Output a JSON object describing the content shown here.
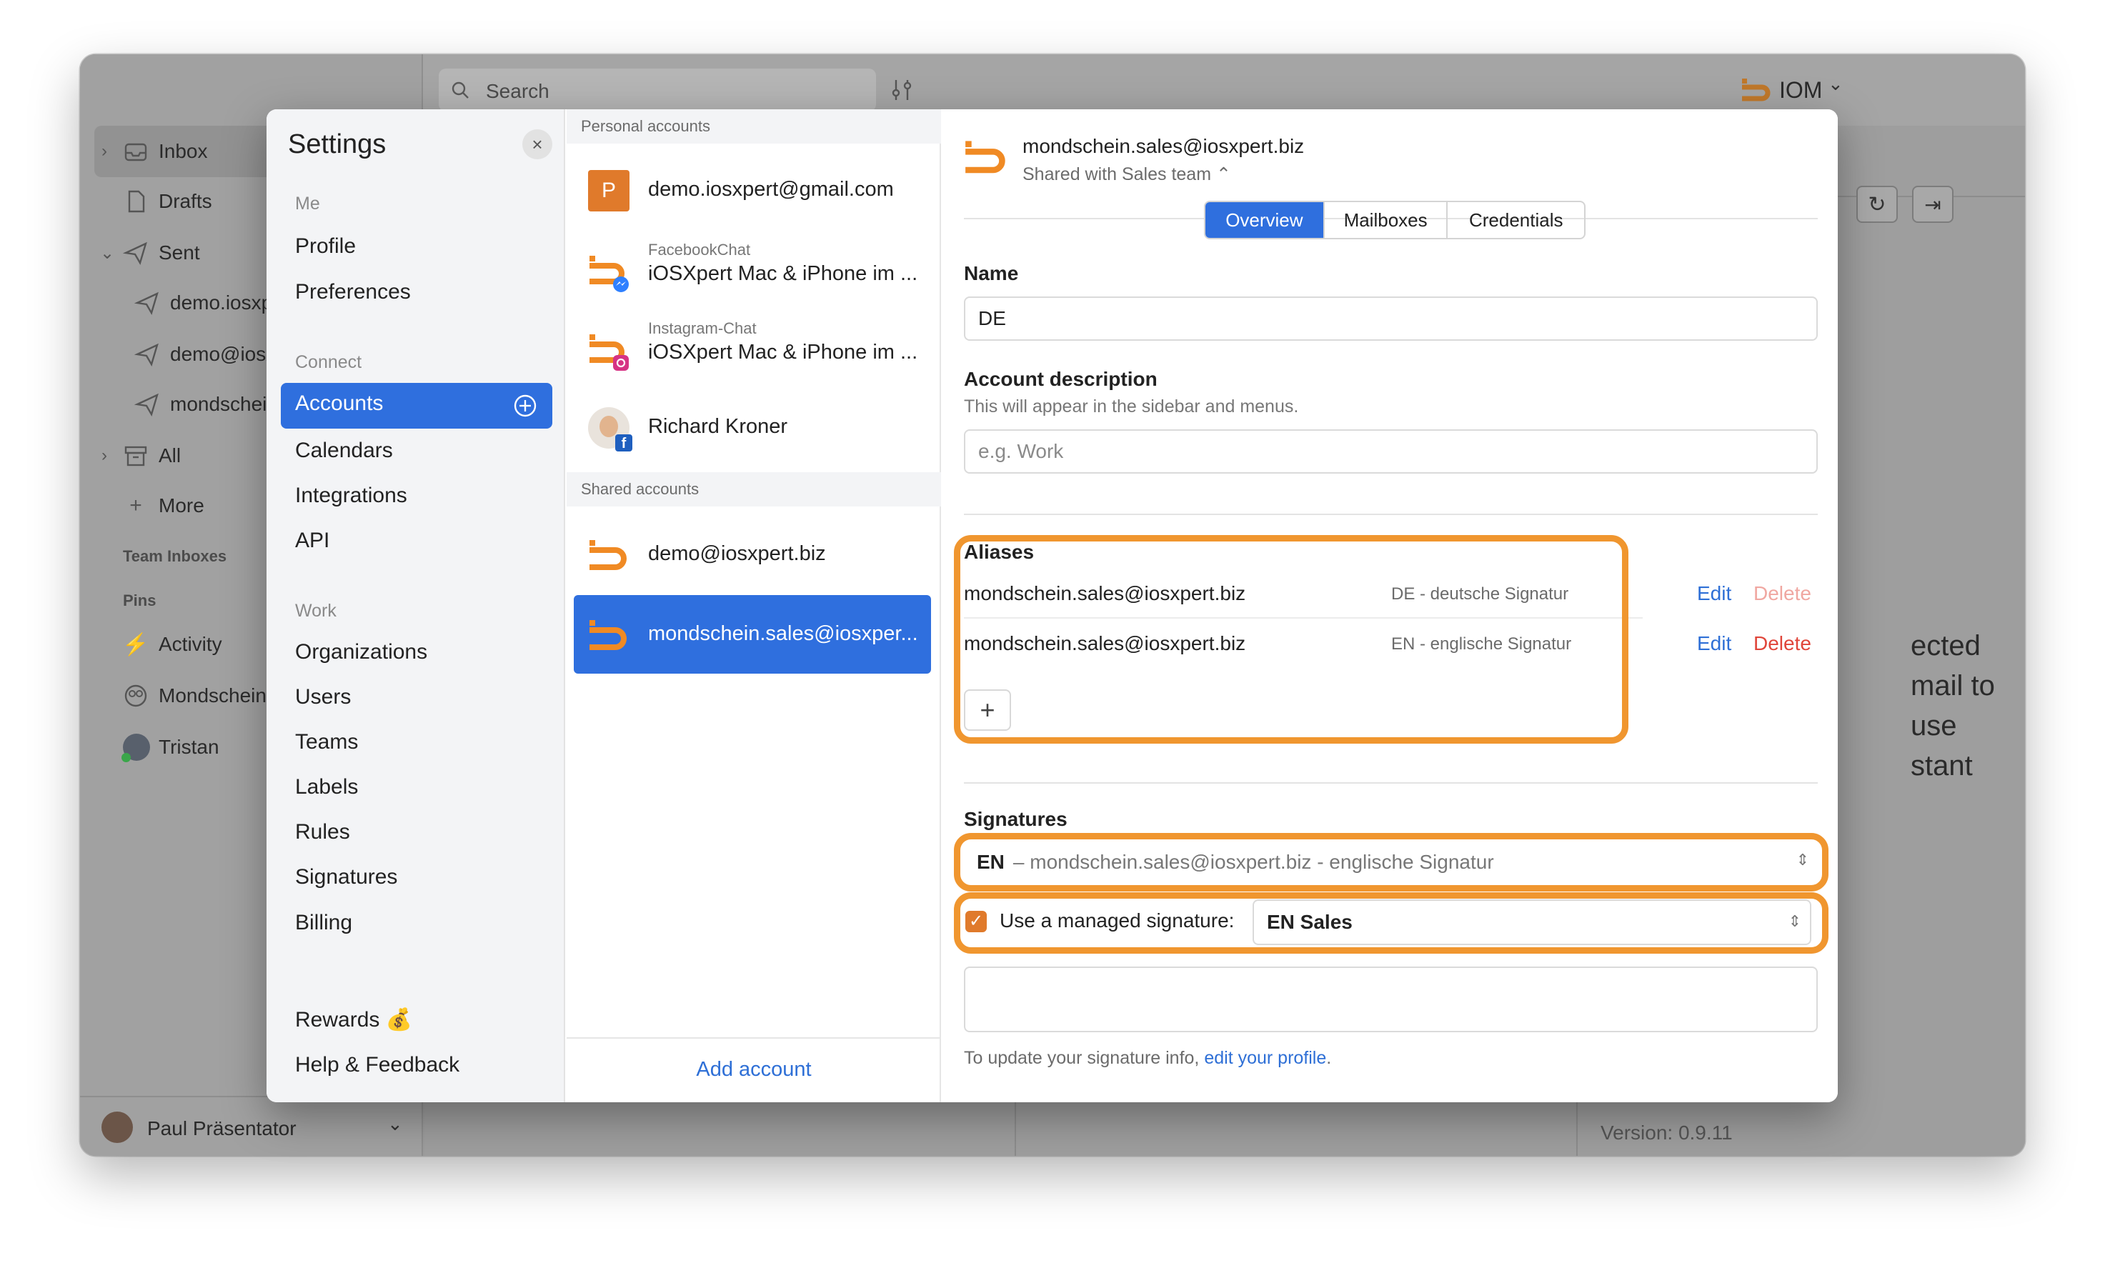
{
  "window": {
    "search_placeholder": "Search",
    "workspace": "IOM",
    "chevron": "⌄"
  },
  "sidebar": {
    "items": [
      {
        "label": "Inbox",
        "icon": "inbox-icon"
      },
      {
        "label": "Drafts",
        "icon": "document-icon"
      },
      {
        "label": "Sent",
        "icon": "send-icon"
      },
      {
        "label": "demo.iosxpert@gmail.com",
        "icon": "send-icon"
      },
      {
        "label": "demo@iosxpert.biz",
        "icon": "send-icon"
      },
      {
        "label": "mondschein.sales@iosxpert.biz",
        "icon": "send-icon"
      },
      {
        "label": "All",
        "icon": "archive-icon"
      },
      {
        "label": "More",
        "icon": "plus-icon"
      }
    ],
    "team_inboxes": "Team Inboxes",
    "pins": "Pins",
    "pin_items": [
      {
        "label": "Activity"
      },
      {
        "label": "Mondschein"
      },
      {
        "label": "Tristan"
      }
    ],
    "user_name": "Paul Präsentator"
  },
  "background": {
    "line1": "ected",
    "line2": "mail to use",
    "line3": "stant",
    "version": "Version: 0.9.11"
  },
  "settings": {
    "title": "Settings",
    "close": "×",
    "groups": [
      {
        "heading": "Me",
        "items": [
          "Profile",
          "Preferences"
        ]
      },
      {
        "heading": "Connect",
        "items": [
          "Accounts",
          "Calendars",
          "Integrations",
          "API"
        ]
      },
      {
        "heading": "Work",
        "items": [
          "Organizations",
          "Users",
          "Teams",
          "Labels",
          "Rules",
          "Signatures",
          "Billing"
        ]
      }
    ],
    "rewards": "Rewards 💰",
    "help": "Help & Feedback",
    "selected": "Accounts"
  },
  "accounts": {
    "personal_heading": "Personal accounts",
    "personal": [
      {
        "name": "demo.iosxpert@gmail.com",
        "sub": "",
        "avatar_letter": "P"
      },
      {
        "name": "iOSXpert Mac & iPhone im ...",
        "sub": "FacebookChat",
        "avatar_letter": ""
      },
      {
        "name": "iOSXpert Mac & iPhone im ...",
        "sub": "Instagram-Chat",
        "avatar_letter": ""
      },
      {
        "name": "Richard Kroner",
        "sub": "",
        "avatar_letter": ""
      }
    ],
    "shared_heading": "Shared accounts",
    "shared": [
      {
        "name": "demo@iosxpert.biz"
      },
      {
        "name": "mondschein.sales@iosxper..."
      }
    ],
    "add_account": "Add account"
  },
  "detail": {
    "account_email": "mondschein.sales@iosxpert.biz",
    "shared_with": "Shared with Sales team ⌃",
    "tabs": [
      "Overview",
      "Mailboxes",
      "Credentials"
    ],
    "active_tab": "Overview",
    "name_label": "Name",
    "name_value": "DE",
    "desc_label": "Account description",
    "desc_hint": "This will appear in the sidebar and menus.",
    "desc_placeholder": "e.g. Work",
    "aliases_label": "Aliases",
    "aliases": [
      {
        "email": "mondschein.sales@iosxpert.biz",
        "signature": "DE - deutsche Signatur",
        "edit": "Edit",
        "delete": "Delete"
      },
      {
        "email": "mondschein.sales@iosxpert.biz",
        "signature": "EN - englische Signatur",
        "edit": "Edit",
        "delete": "Delete"
      }
    ],
    "add_alias": "+",
    "signatures_label": "Signatures",
    "signature_select_bold": "EN",
    "signature_select_rest": "– mondschein.sales@iosxpert.biz - englische Signatur",
    "managed_label": "Use a managed signature:",
    "managed_checked": true,
    "managed_value": "EN Sales",
    "footer_text": "To update your signature info,",
    "footer_link": "edit your profile",
    "footer_end": "."
  },
  "colors": {
    "accent": "#2f6fde",
    "highlight": "#f0962f",
    "delete": "#e0453a",
    "brand_orange": "#f08a24"
  }
}
